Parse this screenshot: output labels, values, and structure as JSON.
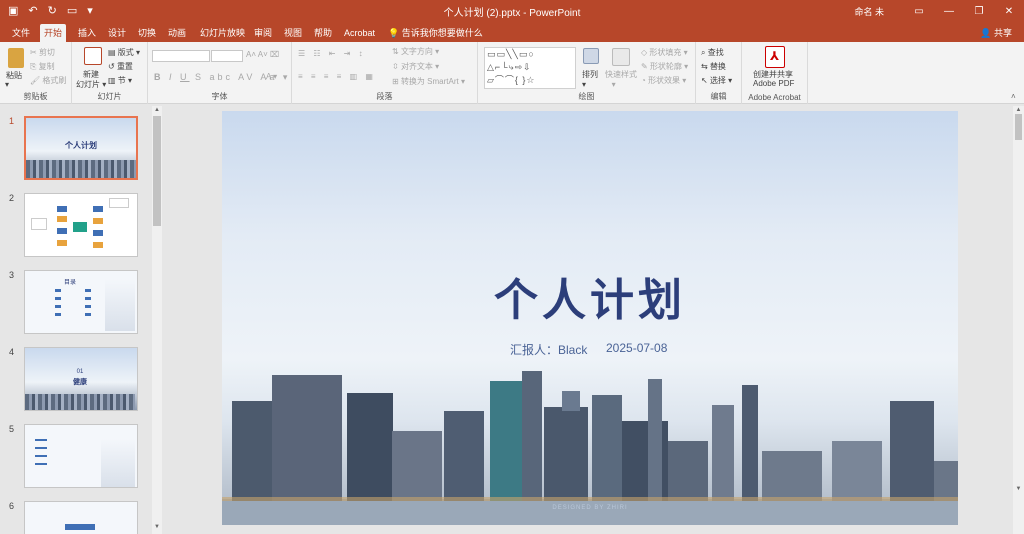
{
  "window": {
    "title": "个人计划 (2).pptx - PowerPoint",
    "user": "命名 未",
    "share": "共享",
    "tell_me": "告诉我你想要做什么"
  },
  "tabs": [
    {
      "label": "文件"
    },
    {
      "label": "开始"
    },
    {
      "label": "插入"
    },
    {
      "label": "设计"
    },
    {
      "label": "切换"
    },
    {
      "label": "动画"
    },
    {
      "label": "幻灯片放映"
    },
    {
      "label": "审阅"
    },
    {
      "label": "视图"
    },
    {
      "label": "帮助"
    },
    {
      "label": "Acrobat"
    }
  ],
  "ribbon": {
    "clipboard": {
      "label": "剪贴板",
      "paste": "粘贴",
      "cut": "剪切",
      "copy": "复制",
      "format_painter": "格式刷"
    },
    "slides": {
      "label": "幻灯片",
      "new_slide": "新建",
      "new_slide2": "幻灯片",
      "layout": "版式",
      "reset": "重置",
      "section": "节"
    },
    "font": {
      "label": "字体"
    },
    "paragraph": {
      "label": "段落",
      "text_direction": "文字方向",
      "align_text": "对齐文本",
      "smartart": "转换为 SmartArt"
    },
    "drawing": {
      "label": "绘图",
      "arrange": "排列",
      "quick_styles": "快速样式",
      "shape_fill": "形状填充",
      "shape_outline": "形状轮廓",
      "shape_effects": "形状效果"
    },
    "editing": {
      "label": "编辑",
      "find": "查找",
      "replace": "替换",
      "select": "选择"
    },
    "acrobat": {
      "label": "Adobe Acrobat",
      "create1": "创建并共享",
      "create2": "Adobe PDF"
    }
  },
  "slides": [
    {
      "num": "1",
      "title": "个人计划"
    },
    {
      "num": "2"
    },
    {
      "num": "3",
      "title": "目录"
    },
    {
      "num": "4",
      "title": "01",
      "subtitle": "健康"
    },
    {
      "num": "5"
    },
    {
      "num": "6"
    }
  ],
  "current_slide": {
    "title": "个人计划",
    "reporter": "汇报人：Black",
    "date": "2025-07-08",
    "credit": "DESIGNED BY ZHIRI"
  },
  "colors": {
    "accent": "#b7472a",
    "slide_title": "#2c3e7a"
  }
}
